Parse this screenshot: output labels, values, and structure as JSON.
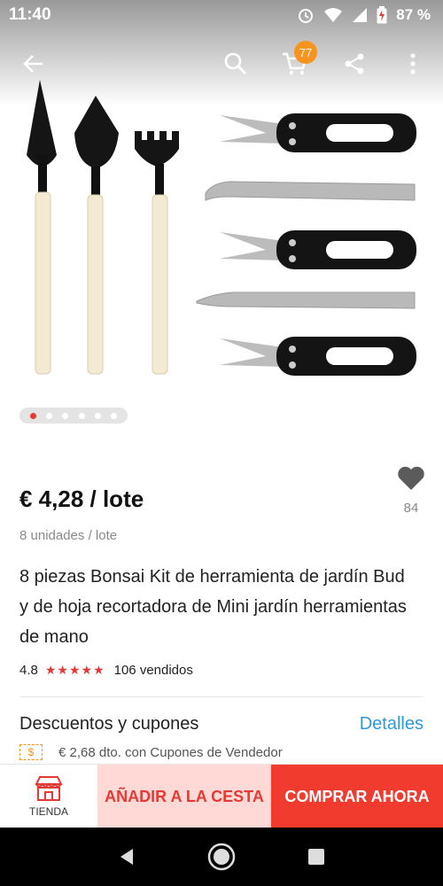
{
  "status_bar": {
    "time": "11:40",
    "battery": "87 %"
  },
  "header": {
    "icons": [
      "back-arrow-icon",
      "search-icon",
      "cart-icon",
      "share-icon",
      "more-vertical-icon"
    ],
    "cart_count": "77"
  },
  "gallery": {
    "image_description": "bonsai-tools-kit-image",
    "pages": 6,
    "active_page": 1
  },
  "product": {
    "price": "€ 4,28 / lote",
    "units": "8 unidades / lote",
    "wishlist_count": "84",
    "title": "8 piezas Bonsai Kit de herramienta de jardín Bud y de hoja recortadora de Mini jardín herramientas de mano",
    "rating": "4.8",
    "stars": "★★★★★",
    "sold": "106 vendidos"
  },
  "coupons": {
    "title": "Descuentos y cupones",
    "link": "Detalles",
    "line": "€ 2,68 dto. con Cupones de Vendedor",
    "icon_glyph": "$"
  },
  "actions": {
    "store_label": "TIENDA",
    "add_to_cart": "AÑADIR A LA CESTA",
    "buy_now": "COMPRAR AHORA"
  },
  "colors": {
    "accent_red": "#f23b2f",
    "cart_bg": "#ffd9d6",
    "link_blue": "#2d9ad8",
    "badge_orange": "#f7931e"
  }
}
